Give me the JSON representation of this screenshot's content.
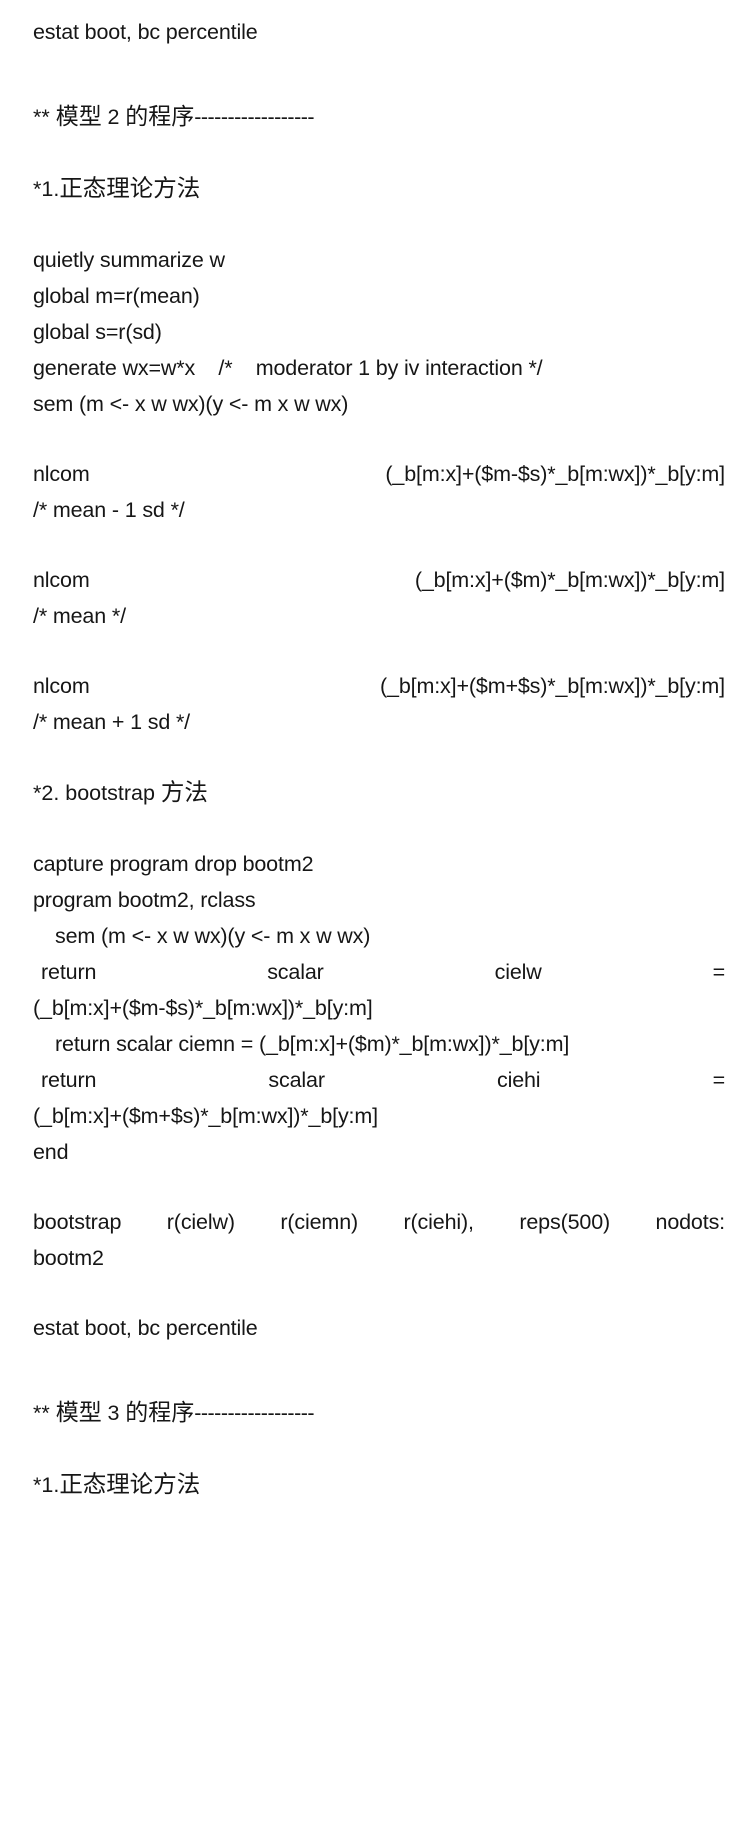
{
  "document": {
    "type": "stata-code-listing",
    "background_color": "#ffffff",
    "text_color": "#161616"
  },
  "blocks": {
    "estat_top": "estat boot, bc percentile",
    "model2_header": {
      "prefix": "** ",
      "cjk_before": "模型 ",
      "number": "2",
      "cjk_after": " 的程序",
      "dashes": "------------------"
    },
    "section1_normal_theory": {
      "marker": "*1.",
      "cjk": "正态理论方法"
    },
    "normal_theory_code": [
      "quietly summarize w",
      "global m=r(mean)",
      "global s=r(sd)",
      "generate wx=w*x    /*    moderator 1 by iv interaction */",
      "sem (m <- x w wx)(y <- m x w wx)"
    ],
    "nlcom_blocks": [
      {
        "command": "nlcom",
        "expression": "(_b[m:x]+($m-$s)*_b[m:wx])*_b[y:m]",
        "comment": "/* mean - 1 sd */"
      },
      {
        "command": "nlcom",
        "expression": "(_b[m:x]+($m)*_b[m:wx])*_b[y:m]",
        "comment": "/* mean */"
      },
      {
        "command": "nlcom",
        "expression": "(_b[m:x]+($m+$s)*_b[m:wx])*_b[y:m]",
        "comment": "/* mean + 1 sd */"
      }
    ],
    "section2_bootstrap": {
      "marker": "*2. bootstrap ",
      "cjk": "方法"
    },
    "bootstrap_program": {
      "drop_line": "capture program drop bootm2",
      "program_line": "program bootm2, rclass",
      "sem_line": "sem (m <- x w wx)(y <- m x w wx)",
      "return_cielw": {
        "words": [
          "return",
          "scalar",
          "cielw",
          "="
        ],
        "continuation": "(_b[m:x]+($m-$s)*_b[m:wx])*_b[y:m]"
      },
      "return_ciemn": "return scalar ciemn = (_b[m:x]+($m)*_b[m:wx])*_b[y:m]",
      "return_ciehi": {
        "words": [
          "return",
          "scalar",
          "ciehi",
          "="
        ],
        "continuation": "(_b[m:x]+($m+$s)*_b[m:wx])*_b[y:m]"
      },
      "end_line": "end"
    },
    "bootstrap_call": {
      "words": [
        "bootstrap",
        "r(cielw)",
        "r(ciemn)",
        "r(ciehi),",
        "reps(500)",
        "nodots:"
      ],
      "continuation": "bootm2"
    },
    "estat_bottom": "estat boot, bc percentile",
    "model3_header": {
      "prefix": "** ",
      "cjk_before": "模型 ",
      "number": "3",
      "cjk_after": " 的程序",
      "dashes": "------------------"
    },
    "section1_normal_theory_2": {
      "marker": "*1.",
      "cjk": "正态理论方法"
    }
  }
}
